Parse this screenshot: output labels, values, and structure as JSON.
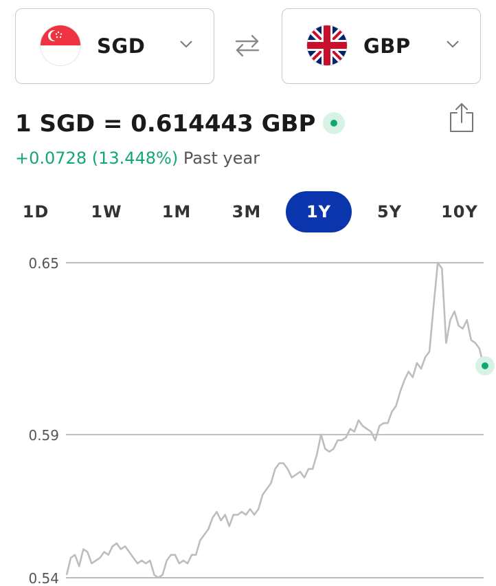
{
  "converter": {
    "from": {
      "code": "SGD",
      "flag_icon": "singapore-flag-icon"
    },
    "to": {
      "code": "GBP",
      "flag_icon": "uk-flag-icon"
    }
  },
  "rate": {
    "text": "1 SGD = 0.614443 GBP",
    "live_color": "#11a870"
  },
  "change": {
    "value_text": "+0.0728 (13.448%)",
    "period_text": "Past year"
  },
  "timeframes": [
    {
      "label": "1D",
      "active": false
    },
    {
      "label": "1W",
      "active": false
    },
    {
      "label": "1M",
      "active": false
    },
    {
      "label": "3M",
      "active": false
    },
    {
      "label": "1Y",
      "active": true
    },
    {
      "label": "5Y",
      "active": false
    },
    {
      "label": "10Y",
      "active": false
    }
  ],
  "colors": {
    "accent": "#0b35ac",
    "positive": "#11a870",
    "line": "#bdbdbd",
    "grid": "#bbbbbb"
  },
  "chart_data": {
    "type": "line",
    "ylim": [
      0.54,
      0.65
    ],
    "y_ticks": [
      "0.65",
      "0.59",
      "0.54"
    ],
    "y_tick_values": [
      0.65,
      0.59,
      0.54
    ],
    "grid": true,
    "series": [
      {
        "values": [
          0.541,
          0.547,
          0.548,
          0.544,
          0.55,
          0.549,
          0.545,
          0.546,
          0.547,
          0.549,
          0.548,
          0.551,
          0.552,
          0.55,
          0.551,
          0.549,
          0.547,
          0.545,
          0.546,
          0.545,
          0.546,
          0.541,
          0.54,
          0.541,
          0.546,
          0.548,
          0.548,
          0.545,
          0.546,
          0.545,
          0.548,
          0.548,
          0.553,
          0.555,
          0.557,
          0.561,
          0.563,
          0.56,
          0.562,
          0.558,
          0.562,
          0.562,
          0.563,
          0.562,
          0.564,
          0.562,
          0.564,
          0.569,
          0.571,
          0.573,
          0.578,
          0.58,
          0.58,
          0.578,
          0.575,
          0.576,
          0.577,
          0.575,
          0.578,
          0.578,
          0.583,
          0.59,
          0.585,
          0.584,
          0.585,
          0.588,
          0.588,
          0.589,
          0.592,
          0.591,
          0.595,
          0.593,
          0.592,
          0.591,
          0.588,
          0.593,
          0.594,
          0.594,
          0.598,
          0.6,
          0.605,
          0.609,
          0.612,
          0.61,
          0.615,
          0.613,
          0.617,
          0.619,
          0.635,
          0.65,
          0.648,
          0.622,
          0.63,
          0.633,
          0.628,
          0.627,
          0.63,
          0.623,
          0.622,
          0.62,
          0.614
        ]
      }
    ]
  }
}
